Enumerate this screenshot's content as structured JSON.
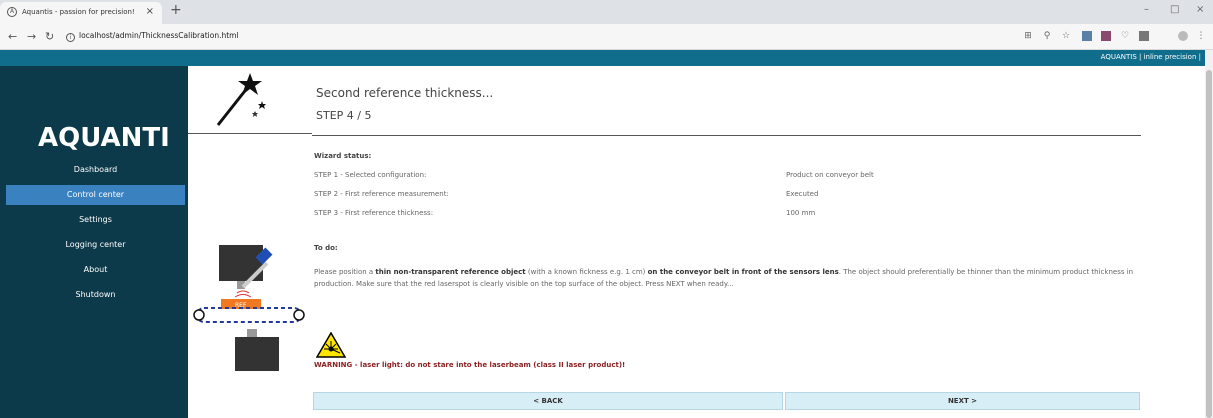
{
  "browser": {
    "tab_title": "Aquantis - passion for precision!",
    "tab_close": "×",
    "new_tab": "+",
    "url": "localhost/admin/ThicknessCalibration.html",
    "win_minimize": "–",
    "win_restore": "□",
    "win_close": "×"
  },
  "app": {
    "brand": "AQUANTIS | inline precision |",
    "logo_text": "AQUANTIS"
  },
  "sidebar": {
    "items": [
      {
        "label": "Dashboard",
        "active": false
      },
      {
        "label": "Control center",
        "active": true
      },
      {
        "label": "Settings",
        "active": false
      },
      {
        "label": "Logging center",
        "active": false
      },
      {
        "label": "About",
        "active": false
      },
      {
        "label": "Shutdown",
        "active": false
      }
    ]
  },
  "wizard": {
    "title": "Second reference thickness...",
    "step": "STEP 4 / 5",
    "status_label": "Wizard status:",
    "status": [
      {
        "key": "STEP 1 - Selected configuration:",
        "value": "Product on conveyor belt"
      },
      {
        "key": "STEP 2 - First reference measurement:",
        "value": "Executed"
      },
      {
        "key": "STEP 3 - First reference thickness:",
        "value": "100 mm"
      }
    ],
    "todo_label": "To do:",
    "todo": {
      "p1": "Please position a ",
      "b1": "thin non-transparent reference object",
      "p2": " (with a known fickness e.g. 1 cm) ",
      "b2": "on the conveyor belt in front of the sensors lens",
      "p3": ". The object should preferentially be thinner than the minimum product thickness in production. Make sure that the red laserspot is clearly visible on the top surface of the object. Press NEXT when ready..."
    },
    "ref_label": "REF",
    "warning": "WARNING - laser light: do not stare into the laserbeam (class II laser product)!",
    "back_label": "< BACK",
    "next_label": "NEXT >"
  },
  "colors": {
    "topbar": "#106e8c",
    "sidebar": "#0d3a4a",
    "active_nav": "#3a81c0",
    "button": "#d8eef6",
    "warning_text": "#8a1f1f"
  }
}
